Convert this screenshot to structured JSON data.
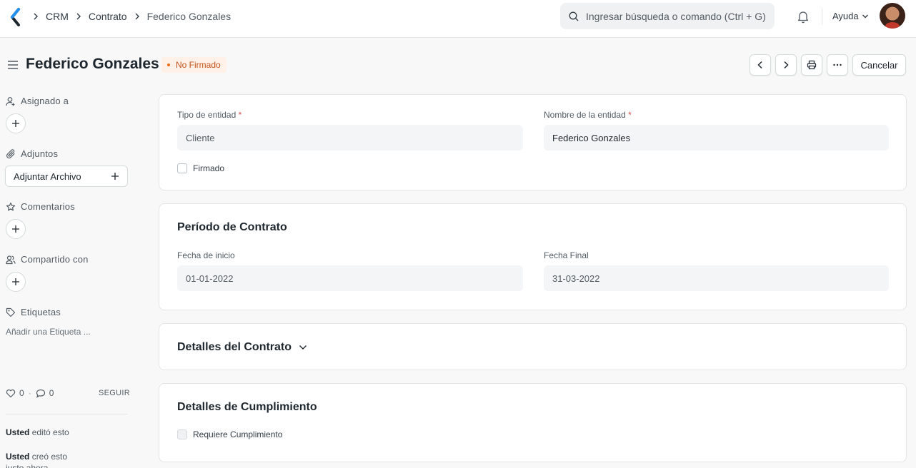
{
  "breadcrumb": [
    "CRM",
    "Contrato",
    "Federico Gonzales"
  ],
  "search": {
    "placeholder": "Ingresar búsqueda o comando (Ctrl + G)"
  },
  "navbar": {
    "help_label": "Ayuda"
  },
  "page": {
    "title": "Federico Gonzales",
    "status": "No Firmado",
    "status_color": "#e86c13",
    "cancel_label": "Cancelar"
  },
  "sidebar": {
    "assigned": "Asignado a",
    "attachments": "Adjuntos",
    "attach_button": "Adjuntar Archivo",
    "comments": "Comentarios",
    "shared": "Compartido con",
    "tags": "Etiquetas",
    "add_tag": "Añadir una Etiqueta ...",
    "likes": "0",
    "comment_count": "0",
    "follow": "SEGUIR",
    "timeline": [
      {
        "user": "Usted",
        "action": "editó esto"
      },
      {
        "user": "Usted",
        "action": "creó esto justo ahora"
      }
    ]
  },
  "form": {
    "entity_type_label": "Tipo de entidad",
    "entity_type_value": "Cliente",
    "entity_name_label": "Nombre de la entidad",
    "entity_name_value": "Federico Gonzales",
    "signed_label": "Firmado",
    "required_mark": "*",
    "period_title": "Período de Contrato",
    "start_label": "Fecha de inicio",
    "start_value": "01-01-2022",
    "end_label": "Fecha Final",
    "end_value": "31-03-2022",
    "details_title": "Detalles del Contrato",
    "fulfilment_title": "Detalles de Cumplimiento",
    "requires_fulfilment_label": "Requiere Cumplimiento"
  }
}
